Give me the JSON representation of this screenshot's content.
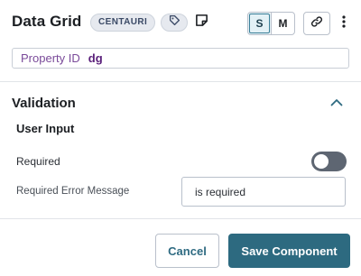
{
  "header": {
    "title": "Data Grid",
    "badge": "CENTAURI",
    "tag_icon": "tag-icon",
    "note_icon": "note-icon",
    "size_options": [
      "S",
      "M"
    ],
    "size_selected": "S",
    "link_icon": "link-icon",
    "menu_icon": "kebab-menu-icon"
  },
  "property": {
    "label": "Property ID",
    "value": "dg"
  },
  "validation": {
    "title": "Validation",
    "expanded": true,
    "subsection": "User Input",
    "required": {
      "label": "Required",
      "enabled": false
    },
    "error_message": {
      "label": "Required Error Message",
      "value": "is required"
    }
  },
  "footer": {
    "cancel_label": "Cancel",
    "save_label": "Save Component"
  },
  "colors": {
    "primary": "#2d6a80",
    "badge_bg": "#e6e9ef",
    "property_label": "#7a4a99",
    "toggle_off": "#5e6672"
  }
}
